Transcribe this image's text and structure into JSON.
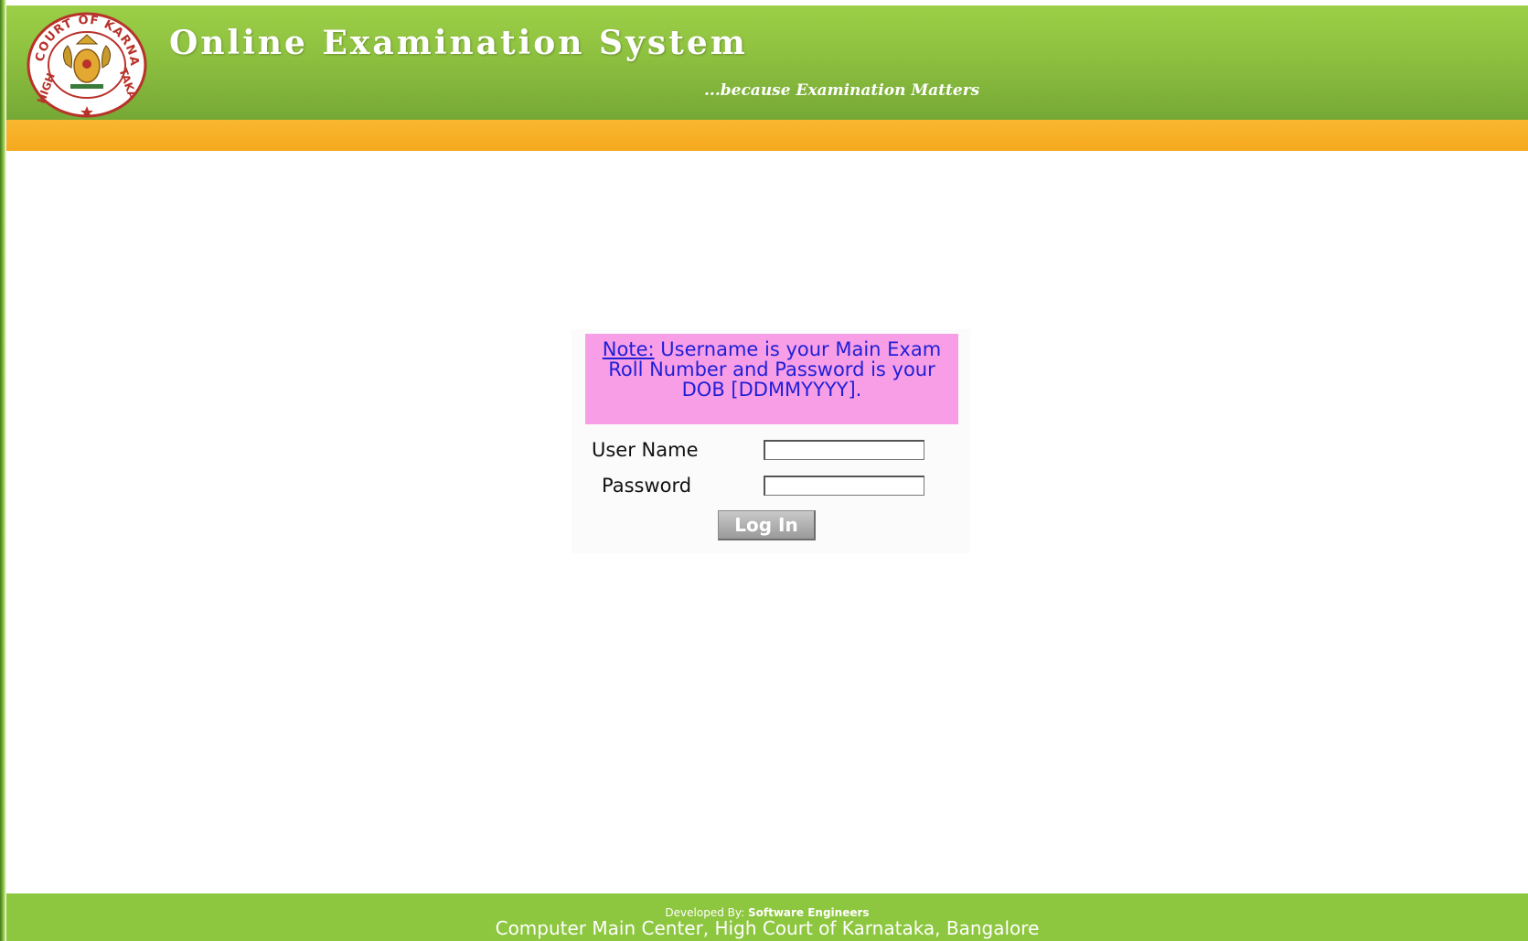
{
  "header": {
    "title": "Online Examination System",
    "tagline": "...because Examination Matters",
    "logo_text": "HIGH COURT OF KARNATAKA",
    "colors": {
      "header_green": "#8dc03f",
      "orange_bar": "#f6a91e"
    }
  },
  "login": {
    "note_label": "Note:",
    "note_text": "Username is your Main Exam Roll Number and Password is your DOB [DDMMYYYY].",
    "username_label": "User Name",
    "username_value": "",
    "password_label": "Password",
    "password_value": "",
    "login_button": "Log In",
    "colors": {
      "note_background": "#f79ee6",
      "note_text": "#1f1fd6"
    }
  },
  "footer": {
    "developed_by_label": "Developed By:",
    "developer": "Software Engineers",
    "organization": "Computer Main Center, High Court of Karnataka, Bangalore",
    "colors": {
      "footer_green": "#8dc63f"
    }
  }
}
